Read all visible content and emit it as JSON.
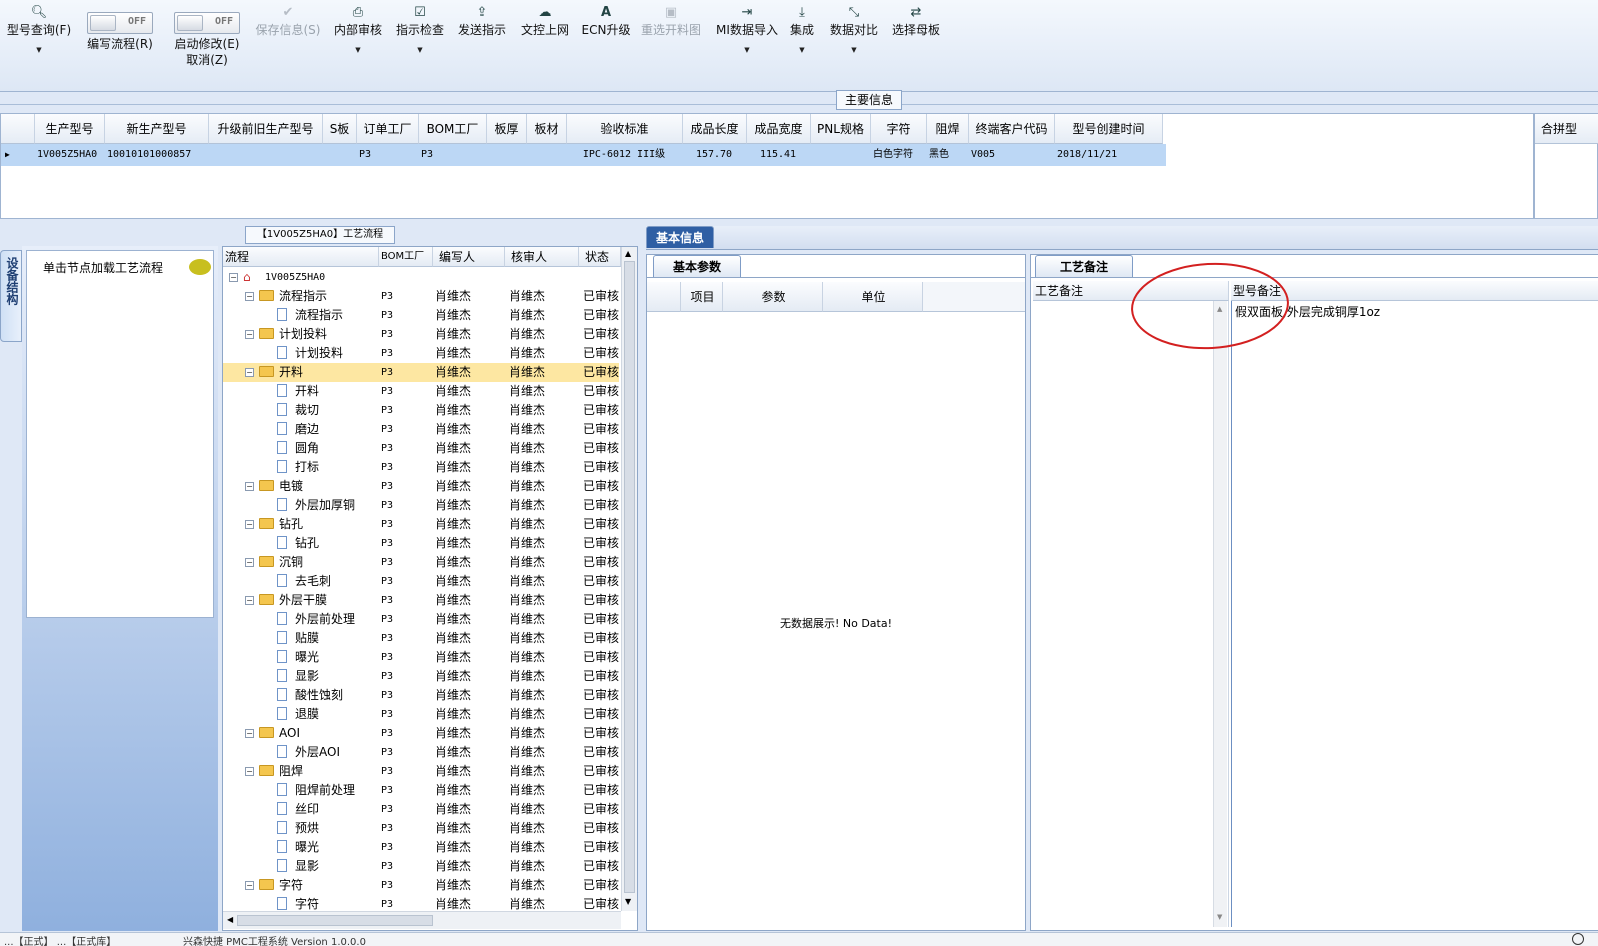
{
  "toolbar": {
    "model_query": "型号查询(F)",
    "write_flow_toggle": "OFF",
    "write_flow": "编写流程(R)",
    "start_modify_toggle": "OFF",
    "start_modify": "启动修改(E)",
    "cancel": "取消(Z)",
    "save_info": "保存信息(S)",
    "internal_review": "内部审核",
    "instruction_check": "指示检查",
    "send_instruction": "发送指示",
    "doc_upload": "文控上网",
    "ecn_upgrade": "ECN升级",
    "reselect_cut_chart": "重选开料图",
    "mi_import": "MI数据导入",
    "integrate": "集成",
    "data_compare": "数据对比",
    "select_master": "选择母板"
  },
  "main_info_label": "主要信息",
  "top_grid": {
    "columns": [
      "生产型号",
      "新生产型号",
      "升级前旧生产型号",
      "S板",
      "订单工厂",
      "BOM工厂",
      "板厚",
      "板材",
      "验收标准",
      "成品长度",
      "成品宽度",
      "PNL规格",
      "字符",
      "阻焊",
      "终端客户代码",
      "型号创建时间"
    ],
    "row": [
      "1V005Z5HA0",
      "10010101000857",
      "",
      "",
      "P3",
      "P3",
      "",
      "",
      "IPC-6012 III级",
      "157.70",
      "115.41",
      "",
      "白色字符",
      "黑色",
      "V005",
      "2018/11/21"
    ],
    "right_header": "合拼型"
  },
  "side_tab": "设备结构",
  "left_panel_hint": "单击节点加载工艺流程",
  "flow_panel": {
    "title": "【1V005Z5HA0】工艺流程",
    "headers": [
      "流程",
      "BOM工厂",
      "编写人",
      "核审人",
      "状态"
    ],
    "root": "1V005Z5HA0",
    "rows": [
      {
        "n": "流程指示",
        "f": "P3",
        "w": "肖维杰",
        "r": "肖维杰",
        "s": "已审核",
        "l": 1
      },
      {
        "n": "流程指示",
        "f": "P3",
        "w": "肖维杰",
        "r": "肖维杰",
        "s": "已审核",
        "l": 2
      },
      {
        "n": "计划投料",
        "f": "P3",
        "w": "肖维杰",
        "r": "肖维杰",
        "s": "已审核",
        "l": 1
      },
      {
        "n": "计划投料",
        "f": "P3",
        "w": "肖维杰",
        "r": "肖维杰",
        "s": "已审核",
        "l": 2
      },
      {
        "n": "开料",
        "f": "P3",
        "w": "肖维杰",
        "r": "肖维杰",
        "s": "已审核",
        "l": 1
      },
      {
        "n": "开料",
        "f": "P3",
        "w": "肖维杰",
        "r": "肖维杰",
        "s": "已审核",
        "l": 2
      },
      {
        "n": "裁切",
        "f": "P3",
        "w": "肖维杰",
        "r": "肖维杰",
        "s": "已审核",
        "l": 2
      },
      {
        "n": "磨边",
        "f": "P3",
        "w": "肖维杰",
        "r": "肖维杰",
        "s": "已审核",
        "l": 2
      },
      {
        "n": "圆角",
        "f": "P3",
        "w": "肖维杰",
        "r": "肖维杰",
        "s": "已审核",
        "l": 2
      },
      {
        "n": "打标",
        "f": "P3",
        "w": "肖维杰",
        "r": "肖维杰",
        "s": "已审核",
        "l": 2
      },
      {
        "n": "电镀",
        "f": "P3",
        "w": "肖维杰",
        "r": "肖维杰",
        "s": "已审核",
        "l": 1
      },
      {
        "n": "外层加厚铜",
        "f": "P3",
        "w": "肖维杰",
        "r": "肖维杰",
        "s": "已审核",
        "l": 2
      },
      {
        "n": "钻孔",
        "f": "P3",
        "w": "肖维杰",
        "r": "肖维杰",
        "s": "已审核",
        "l": 1
      },
      {
        "n": "钻孔",
        "f": "P3",
        "w": "肖维杰",
        "r": "肖维杰",
        "s": "已审核",
        "l": 2
      },
      {
        "n": "沉铜",
        "f": "P3",
        "w": "肖维杰",
        "r": "肖维杰",
        "s": "已审核",
        "l": 1
      },
      {
        "n": "去毛刺",
        "f": "P3",
        "w": "肖维杰",
        "r": "肖维杰",
        "s": "已审核",
        "l": 2
      },
      {
        "n": "外层干膜",
        "f": "P3",
        "w": "肖维杰",
        "r": "肖维杰",
        "s": "已审核",
        "l": 1
      },
      {
        "n": "外层前处理",
        "f": "P3",
        "w": "肖维杰",
        "r": "肖维杰",
        "s": "已审核",
        "l": 2
      },
      {
        "n": "贴膜",
        "f": "P3",
        "w": "肖维杰",
        "r": "肖维杰",
        "s": "已审核",
        "l": 2
      },
      {
        "n": "曝光",
        "f": "P3",
        "w": "肖维杰",
        "r": "肖维杰",
        "s": "已审核",
        "l": 2
      },
      {
        "n": "显影",
        "f": "P3",
        "w": "肖维杰",
        "r": "肖维杰",
        "s": "已审核",
        "l": 2
      },
      {
        "n": "酸性蚀刻",
        "f": "P3",
        "w": "肖维杰",
        "r": "肖维杰",
        "s": "已审核",
        "l": 2
      },
      {
        "n": "退膜",
        "f": "P3",
        "w": "肖维杰",
        "r": "肖维杰",
        "s": "已审核",
        "l": 2
      },
      {
        "n": "AOI",
        "f": "P3",
        "w": "肖维杰",
        "r": "肖维杰",
        "s": "已审核",
        "l": 1
      },
      {
        "n": "外层AOI",
        "f": "P3",
        "w": "肖维杰",
        "r": "肖维杰",
        "s": "已审核",
        "l": 2
      },
      {
        "n": "阻焊",
        "f": "P3",
        "w": "肖维杰",
        "r": "肖维杰",
        "s": "已审核",
        "l": 1
      },
      {
        "n": "阻焊前处理",
        "f": "P3",
        "w": "肖维杰",
        "r": "肖维杰",
        "s": "已审核",
        "l": 2
      },
      {
        "n": "丝印",
        "f": "P3",
        "w": "肖维杰",
        "r": "肖维杰",
        "s": "已审核",
        "l": 2
      },
      {
        "n": "预烘",
        "f": "P3",
        "w": "肖维杰",
        "r": "肖维杰",
        "s": "已审核",
        "l": 2
      },
      {
        "n": "曝光",
        "f": "P3",
        "w": "肖维杰",
        "r": "肖维杰",
        "s": "已审核",
        "l": 2
      },
      {
        "n": "显影",
        "f": "P3",
        "w": "肖维杰",
        "r": "肖维杰",
        "s": "已审核",
        "l": 2
      },
      {
        "n": "字符",
        "f": "P3",
        "w": "肖维杰",
        "r": "肖维杰",
        "s": "已审核",
        "l": 1
      },
      {
        "n": "字符",
        "f": "P3",
        "w": "肖维杰",
        "r": "肖维杰",
        "s": "已审核",
        "l": 2
      }
    ],
    "selected_index": 4
  },
  "basic_info": {
    "tab": "基本信息",
    "sub_tab": "基本参数",
    "headers": [
      "项目",
      "参数",
      "单位"
    ],
    "empty": "无数据展示! No Data!"
  },
  "process_note": {
    "tab": "工艺备注",
    "col1": "工艺备注",
    "col2": "型号备注",
    "model_note": "假双面板,外层完成铜厚1oz"
  },
  "status_bar": "...【正式】 ...【正式库】                     兴森快捷 PMC工程系统 Version 1.0.0.0",
  "colors": {
    "selected_row": "#fde7a2",
    "grid_selection": "#bcd7f5",
    "annotation_circle": "#d32020",
    "accent": "#2f5fa4"
  }
}
